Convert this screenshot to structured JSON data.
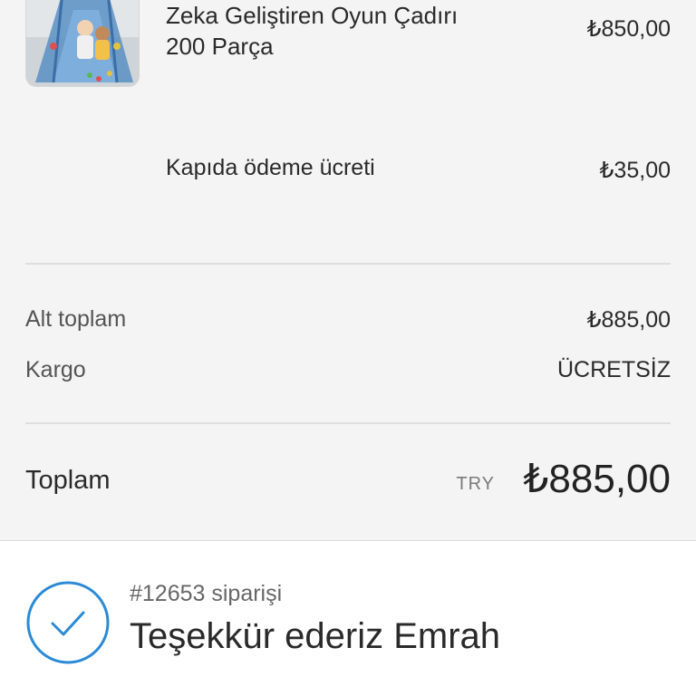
{
  "order_summary": {
    "items": [
      {
        "name_line1": "Zeka Geliştiren Oyun Çadırı",
        "name_line2": "200 Parça",
        "price": "₺850,00",
        "image_icon": "play-tent-product-photo"
      }
    ],
    "cod_fee": {
      "label": "Kapıda ödeme ücreti",
      "value": "₺35,00"
    },
    "subtotal": {
      "label": "Alt toplam",
      "value": "₺885,00"
    },
    "shipping": {
      "label": "Kargo",
      "value": "ÜCRETSİZ"
    },
    "total": {
      "label": "Toplam",
      "currency": "TRY",
      "value": "₺885,00"
    }
  },
  "confirmation": {
    "order_number": "#12653 siparişi",
    "thank_you": "Teşekkür ederiz Emrah",
    "icon": "check-circle-icon",
    "accent_color": "#2b8ad6"
  }
}
